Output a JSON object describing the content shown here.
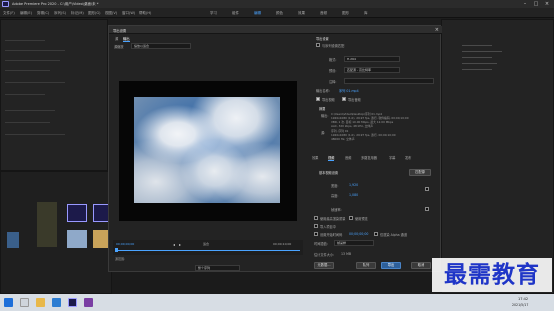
{
  "titlebar": {
    "title": "Adobe Premiere Pro 2020 - C:\\用户\\Video\\桌面\\未 *"
  },
  "menu": {
    "items": [
      "文件(F)",
      "编辑(E)",
      "剪辑(C)",
      "序列(S)",
      "标记(M)",
      "图形(G)",
      "视图(V)",
      "窗口(W)",
      "帮助(H)"
    ],
    "workspaces": [
      "学习",
      "组件",
      "编辑",
      "颜色",
      "效果",
      "音频",
      "图形",
      "库"
    ],
    "active_workspace": "编辑"
  },
  "dialog": {
    "title": "导出设置",
    "tabs": [
      "源",
      "输出"
    ],
    "source_scaling": "缩放以适合",
    "source_scaling_label": "源缩放",
    "source_range_label": "源范围:",
    "source_range": "整个序列",
    "timecode_start": "00;00;00;00",
    "timecode_end": "00;00;10;00",
    "fit_label": "适合",
    "export_settings_header": "导出设置",
    "match_sequence": "与序列设置匹配",
    "format_label": "格式:",
    "format_value": "H.264",
    "preset_label": "预设:",
    "preset_value": "匹配源 - 高比特率",
    "comments_label": "注释:",
    "output_name_label": "输出名称:",
    "output_name": "序列 01.mp4",
    "export_video": "导出视频",
    "export_audio": "导出音频",
    "summary_header": "摘要",
    "summary_output_label": "输出:",
    "summary_output": [
      "C:\\Users\\Video\\Desktop\\序列 01.mp4",
      "1920x1080 (1.0), 29.97 fps, 逐行, 软件编码, 00;00;10;00",
      "VBR, 1 次, 目标 10.00 Mbps, 最大 12.00 Mbps",
      "AAC, 320 kbps, 48 kHz, 立体声"
    ],
    "summary_source_label": "源:",
    "summary_source": [
      "序列, 序列 01",
      "1920x1080 (1.0), 29.97 fps, 逐行, 00;00;10;00",
      "48000 Hz, 立体声"
    ],
    "setting_tabs": [
      "效果",
      "视频",
      "音频",
      "多路复用器",
      "字幕",
      "发布"
    ],
    "active_setting_tab": "视频",
    "basic_video_header": "基本视频设置",
    "match_source_btn": "匹配源",
    "width_label": "宽度:",
    "width_value": "1,920",
    "height_label": "高度:",
    "height_value": "1,080",
    "frame_rate_label": "帧速率:",
    "use_max_render": "使用最高渲染质量",
    "use_previews": "使用预览",
    "set_start_tc": "设置开始时间码",
    "start_tc": "00;00;00;00",
    "render_alpha": "仅渲染 Alpha 通道",
    "import_into_project": "导入项目中",
    "time_interp_label": "时间插值:",
    "time_interp": "帧采样",
    "file_size_label": "估计文件大小:",
    "file_size": "13 MB",
    "metadata_btn": "元数据...",
    "queue_btn": "队列",
    "export_btn": "导出",
    "cancel_btn": "取消"
  },
  "watermark": "最需教育",
  "taskbar": {
    "time": "17:42",
    "date": "2021/5/17"
  }
}
